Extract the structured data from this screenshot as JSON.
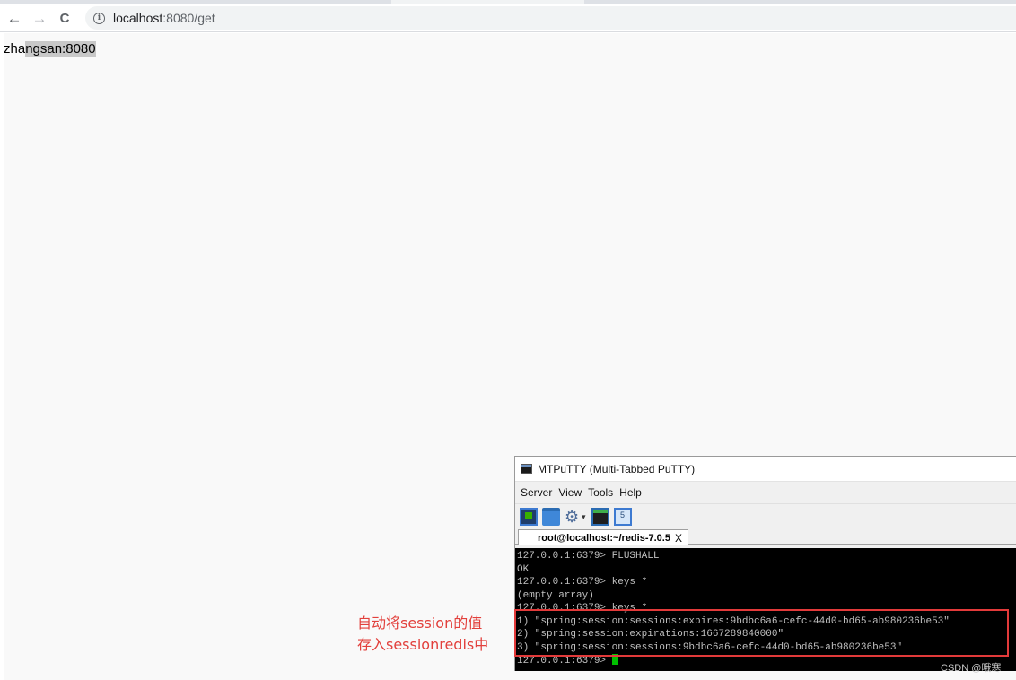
{
  "browser": {
    "url_host": "localhost",
    "url_path": ":8080/get",
    "back_icon": "←",
    "forward_icon": "→",
    "reload_icon": "C",
    "info_icon": "i"
  },
  "page": {
    "text_before_selection": "zha",
    "text_selected": "ngsan:8080"
  },
  "putty": {
    "title": "MTPuTTY (Multi-Tabbed PuTTY)",
    "menu": [
      "Server",
      "View",
      "Tools",
      "Help"
    ],
    "tab_label": "root@localhost:~/redis-7.0.5",
    "tab_close": "X",
    "terminal_lines": [
      "127.0.0.1:6379> FLUSHALL",
      "OK",
      "127.0.0.1:6379> keys *",
      "(empty array)",
      "127.0.0.1:6379> keys *",
      "1) \"spring:session:sessions:expires:9bdbc6a6-cefc-44d0-bd65-ab980236be53\"",
      "2) \"spring:session:expirations:1667289840000\"",
      "3) \"spring:session:sessions:9bdbc6a6-cefc-44d0-bd65-ab980236be53\"",
      "127.0.0.1:6379> "
    ]
  },
  "annotation": {
    "line1": "自动将session的值",
    "line2": "存入sessionredis中"
  },
  "watermark": "CSDN @哦寒",
  "colors": {
    "annotation": "#e2403c",
    "terminal_bg": "#000000",
    "terminal_fg": "#c0c0c0",
    "cursor": "#00c000"
  }
}
